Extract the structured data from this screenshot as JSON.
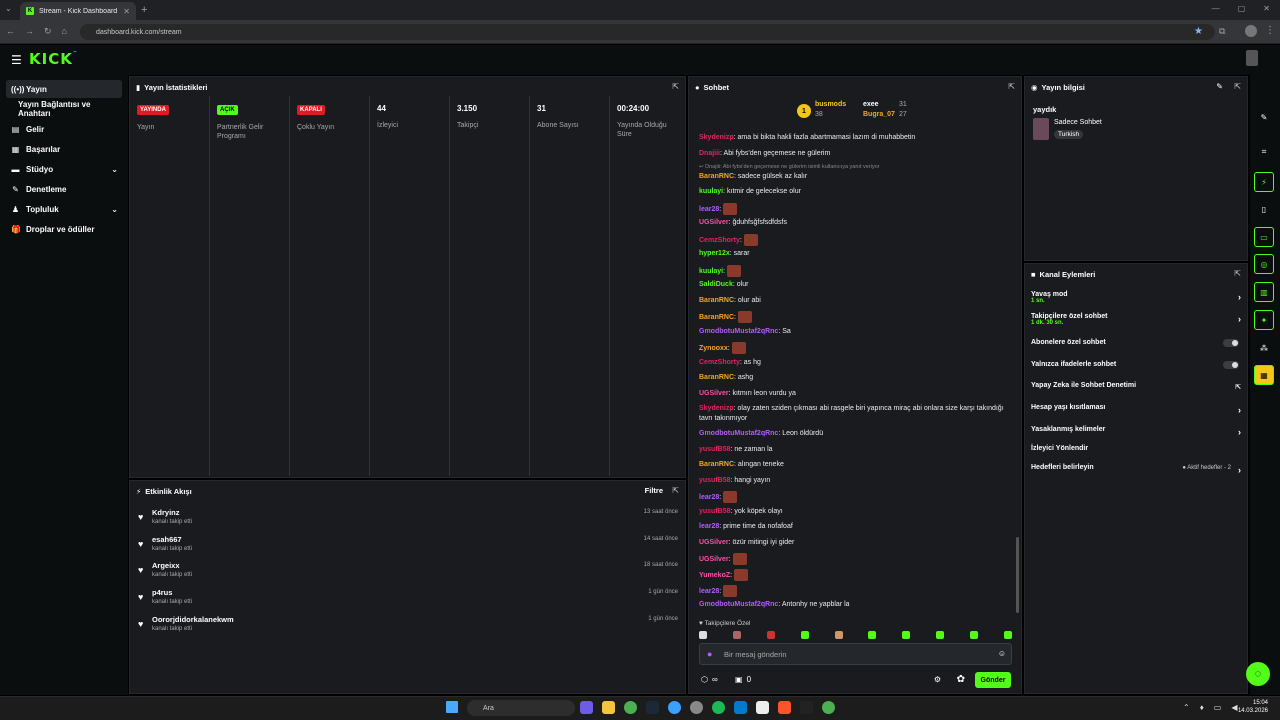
{
  "browser": {
    "tab_title": "Stream - Kick Dashboard",
    "url": "dashboard.kick.com/stream",
    "new_tab": "+"
  },
  "brand": {
    "logo": "KICK",
    "tm": "™",
    "accent": "#53fc18"
  },
  "sidebar": {
    "items": [
      {
        "label": "Yayın",
        "icon": "stream-icon"
      },
      {
        "label": "Yayın Bağlantısı ve Anahtarı",
        "icon": "key-icon"
      },
      {
        "label": "Gelir",
        "icon": "money-icon"
      },
      {
        "label": "Başarılar",
        "icon": "trophy-icon"
      },
      {
        "label": "Stüdyo",
        "icon": "studio-icon"
      },
      {
        "label": "Denetleme",
        "icon": "moderation-icon"
      },
      {
        "label": "Topluluk",
        "icon": "community-icon"
      },
      {
        "label": "Droplar ve ödüller",
        "icon": "gift-icon"
      }
    ]
  },
  "stats": {
    "title": "Yayın İstatistikleri",
    "items": [
      {
        "badge": "YAYINDA",
        "label": "Yayın"
      },
      {
        "badge": "AÇIK",
        "label": "Partnerlik Gelir Programı"
      },
      {
        "badge": "KAPALI",
        "label": "Çoklu Yayın"
      },
      {
        "value": "44",
        "label": "İzleyici"
      },
      {
        "value": "3.150",
        "label": "Takipçi"
      },
      {
        "value": "31",
        "label": "Abone Sayısı"
      },
      {
        "value": "00:24:00",
        "label": "Yayında Olduğu Süre"
      }
    ]
  },
  "activity": {
    "title": "Etkinlik Akışı",
    "filter": "Filtre",
    "items": [
      {
        "name": "Kdryinz",
        "sub": "kanalı takip etti",
        "time": "13 saat önce"
      },
      {
        "name": "esah667",
        "sub": "kanalı takip etti",
        "time": "14 saat önce"
      },
      {
        "name": "Argeixx",
        "sub": "kanalı takip etti",
        "time": "18 saat önce"
      },
      {
        "name": "p4rus",
        "sub": "kanalı takip etti",
        "time": "1 gün önce"
      },
      {
        "name": "Oororjdidorkalanekwm",
        "sub": "kanalı takip etti",
        "time": "1 gün önce"
      }
    ]
  },
  "chat": {
    "title": "Sohbet",
    "pinned": {
      "u1": "busmods",
      "c1": "38",
      "u2": "exee",
      "c2": "31",
      "u3": "Bugra_07",
      "c3": "27",
      "rank": "1"
    },
    "messages": [
      {
        "u": "Skydenizp",
        "c": "#e0245e",
        "t": ": ama bi bikta hakli fazla abartmamasi lazım di muhabbetin"
      },
      {
        "u": "Dnajiii",
        "c": "#e0245e",
        "t": ": Abi fybs'den geçemese ne gülerim"
      },
      {
        "u": "",
        "c": "#888",
        "t": "↩ Dnajiii: Abi fybs'den geçemese ne gülerim isimli kullanıcıya yanıt veriyor"
      },
      {
        "u": "BaranRNC",
        "c": "#f5a623",
        "t": ": sadece gülsek az kalır"
      },
      {
        "u": "kuulayi",
        "c": "#53fc18",
        "t": ": kıtmir de gelecekse olur"
      },
      {
        "u": "lear28",
        "c": "#b45cff",
        "t": ":"
      },
      {
        "u": "UGSilver",
        "c": "#ff4da6",
        "t": ": ğduhfsğfsfsdfdsfs"
      },
      {
        "u": "CemzShorty",
        "c": "#e0245e",
        "t": ":"
      },
      {
        "u": "hyper12x",
        "c": "#53fc18",
        "t": ": sarar"
      },
      {
        "u": "kuulayi",
        "c": "#53fc18",
        "t": ":"
      },
      {
        "u": "SaldiDuck",
        "c": "#53fc18",
        "t": ": olur"
      },
      {
        "u": "BaranRNC",
        "c": "#f5a623",
        "t": ": olur abi"
      },
      {
        "u": "BaranRNC",
        "c": "#f5a623",
        "t": ":"
      },
      {
        "u": "GmodbotuMustaf2qRnc",
        "c": "#b45cff",
        "t": ": Sa"
      },
      {
        "u": "Zynooxx",
        "c": "#f5a623",
        "t": ":"
      },
      {
        "u": "CemzShorty",
        "c": "#e0245e",
        "t": ": as hg"
      },
      {
        "u": "BaranRNC",
        "c": "#f5a623",
        "t": ": ashg"
      },
      {
        "u": "UGSilver",
        "c": "#ff4da6",
        "t": ": kıtmırı leon vurdu ya"
      },
      {
        "u": "Skydenizp",
        "c": "#e0245e",
        "t": ": olay zaten sziden çıkması abi rasgele biri yapınca miraç abi onlara size karşı takındığı tavrı takınmıyor"
      },
      {
        "u": "GmodbotuMustaf2qRnc",
        "c": "#b45cff",
        "t": ": Leon öldürdü"
      },
      {
        "u": "yusufB58",
        "c": "#e0245e",
        "t": ": ne zaman la"
      },
      {
        "u": "BaranRNC",
        "c": "#f5a623",
        "t": ": alıngan teneke"
      },
      {
        "u": "yusufB58",
        "c": "#e0245e",
        "t": ": hangi yayın"
      },
      {
        "u": "lear28",
        "c": "#b45cff",
        "t": ":"
      },
      {
        "u": "yusufB58",
        "c": "#e0245e",
        "t": ": yok köpek olayı"
      },
      {
        "u": "lear28",
        "c": "#b45cff",
        "t": ": prime time da nofafoaf"
      },
      {
        "u": "UGSilver",
        "c": "#ff4da6",
        "t": ": özür mitingi iyi gider"
      },
      {
        "u": "UGSilver",
        "c": "#ff4da6",
        "t": ":"
      },
      {
        "u": "YumekoZ",
        "c": "#ff4da6",
        "t": ":"
      },
      {
        "u": "lear28",
        "c": "#b45cff",
        "t": ":"
      },
      {
        "u": "GmodbotuMustaf2qRnc",
        "c": "#b45cff",
        "t": ": Antonhy ne yapblar la"
      }
    ],
    "followers_only": "♥ Takipçilere Özel",
    "placeholder": "Bir mesaj gönderin",
    "send": "Gönder",
    "points": "∞",
    "count": "0"
  },
  "streaminfo": {
    "title": "Yayın bilgisi",
    "stream_title": "yaydık",
    "tag1": "Sadece Sohbet",
    "tag2": "Turkish"
  },
  "channel": {
    "title": "Kanal Eylemleri",
    "rows": [
      {
        "label": "Yavaş mod",
        "sub": "1 sn."
      },
      {
        "label": "Takipçilere özel sohbet",
        "sub": "1 dk. 30 sn."
      },
      {
        "label": "Abonelere özel sohbet",
        "sub": ""
      },
      {
        "label": "Yalnızca ifadelerle sohbet",
        "sub": ""
      },
      {
        "label": "Yapay Zeka ile Sohbet Denetimi",
        "sub": ""
      },
      {
        "label": "Hesap yaşı kısıtlaması",
        "sub": ""
      },
      {
        "label": "Yasaklanmış kelimeler",
        "sub": ""
      },
      {
        "label": "İzleyici Yönlendir",
        "sub": ""
      },
      {
        "label": "Hedefleri belirleyin",
        "sub": ""
      }
    ],
    "goal_status": "● Aktif hedefler - 2"
  },
  "taskbar": {
    "search": "Ara",
    "time": "15:04",
    "date": "14.03.2026"
  }
}
